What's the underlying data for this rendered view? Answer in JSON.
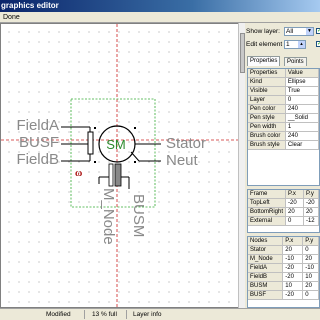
{
  "window": {
    "title": "graphics editor"
  },
  "menu": {
    "items": [
      "Done"
    ]
  },
  "right_panel": {
    "show_layer_label": "Show layer:",
    "show_layer_value": "All",
    "edit_element_label": "Edit element",
    "edit_element_value": "1",
    "tabs": [
      "Properties",
      "Points"
    ],
    "properties": {
      "headers": [
        "Properties",
        "Value"
      ],
      "rows": [
        [
          "Kind",
          "Ellipse"
        ],
        [
          "Visible",
          "True"
        ],
        [
          "Layer",
          "0"
        ],
        [
          "Pen color",
          "240"
        ],
        [
          "Pen style",
          "__Solid"
        ],
        [
          "Pen width",
          "1"
        ],
        [
          "Brush color",
          "240"
        ],
        [
          "Brush style",
          "Clear"
        ]
      ]
    },
    "frame": {
      "headers": [
        "Frame",
        "P.x",
        "P.y"
      ],
      "rows": [
        [
          "TopLeft",
          "-20",
          "-20"
        ],
        [
          "BottomRight",
          "20",
          "20"
        ],
        [
          "External",
          "0",
          "-12"
        ]
      ]
    },
    "nodes": {
      "headers": [
        "Nodes",
        "P.x",
        "P.y"
      ],
      "rows": [
        [
          "Stator",
          "20",
          "0"
        ],
        [
          "M_Node",
          "-10",
          "20"
        ],
        [
          "FieldA",
          "-20",
          "-10"
        ],
        [
          "FieldB",
          "-20",
          "10"
        ],
        [
          "BUSM",
          "10",
          "20"
        ],
        [
          "BUSF",
          "-20",
          "0"
        ]
      ]
    }
  },
  "diagram": {
    "labels": {
      "field_a": "FieldA",
      "busf": "BUSF",
      "field_b": "FieldB",
      "stator": "Stator",
      "neut": "Neut",
      "m_node": "M_Node",
      "busm": "BUSM",
      "sm": "SM",
      "omega": "ω"
    },
    "colors": {
      "sm_green": "#2e8b2e",
      "frame_green": "#33aa33",
      "axis_red": "#cc2222",
      "omega_red": "#aa1111",
      "label_gray": "#8a8a8a"
    }
  },
  "status": {
    "modified": "Modified",
    "fill": "13 % full",
    "layer_info": "Layer info"
  }
}
